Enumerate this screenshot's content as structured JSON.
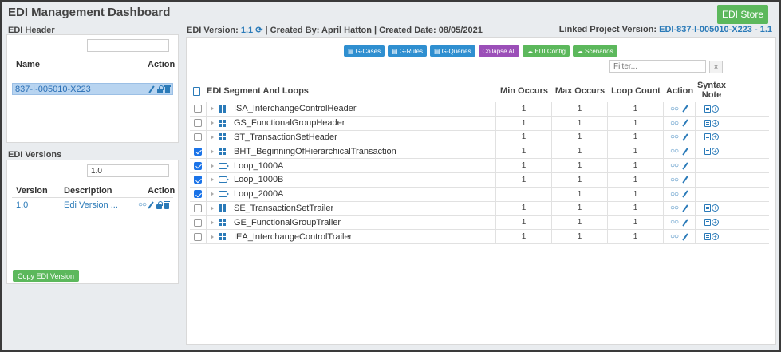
{
  "app": {
    "title": "EDI Management Dashboard",
    "store_button": "EDI Store"
  },
  "edi_header": {
    "section_label": "EDI Header",
    "search_value": "",
    "col_name": "Name",
    "col_action": "Action",
    "rows": [
      {
        "name": "837-I-005010-X223"
      }
    ]
  },
  "edi_versions": {
    "section_label": "EDI Versions",
    "search_value": "1.0",
    "col_version": "Version",
    "col_description": "Description",
    "col_action": "Action",
    "rows": [
      {
        "version": "1.0",
        "description": "Edi Version ..."
      }
    ],
    "copy_button": "Copy EDI Version"
  },
  "meta": {
    "version_label": "EDI Version:",
    "version_value": "1.1",
    "created_by_label": "| Created By:",
    "created_by_value": "April Hatton",
    "created_date_label": "| Created Date:",
    "created_date_value": "08/05/2021",
    "linked_label": "Linked Project Version:",
    "linked_value": "EDI-837-I-005010-X223 - 1.1"
  },
  "toolbar": {
    "g_cases": "G-Cases",
    "g_rules": "G-Rules",
    "g_queries": "G-Queries",
    "collapse_all": "Collapse All",
    "edi_config": "EDI Config",
    "scenarios": "Scenarios"
  },
  "filter": {
    "placeholder": "Filter...",
    "clear_label": "×"
  },
  "grid": {
    "col_segment": "EDI Segment And Loops",
    "col_min": "Min Occurs",
    "col_max": "Max Occurs",
    "col_loop": "Loop Count",
    "col_action": "Action",
    "col_syntax_line1": "Syntax",
    "col_syntax_line2": "Note",
    "rows": [
      {
        "name": "ISA_InterchangeControlHeader",
        "type": "segment",
        "checked": false,
        "min": "1",
        "max": "1",
        "loop": "1",
        "note": true
      },
      {
        "name": "GS_FunctionalGroupHeader",
        "type": "segment",
        "checked": false,
        "min": "1",
        "max": "1",
        "loop": "1",
        "note": true
      },
      {
        "name": "ST_TransactionSetHeader",
        "type": "segment",
        "checked": false,
        "min": "1",
        "max": "1",
        "loop": "1",
        "note": true
      },
      {
        "name": "BHT_BeginningOfHierarchicalTransaction",
        "type": "segment",
        "checked": true,
        "min": "1",
        "max": "1",
        "loop": "1",
        "note": true
      },
      {
        "name": "Loop_1000A",
        "type": "loop",
        "checked": true,
        "min": "1",
        "max": "1",
        "loop": "1",
        "note": false
      },
      {
        "name": "Loop_1000B",
        "type": "loop",
        "checked": true,
        "min": "1",
        "max": "1",
        "loop": "1",
        "note": false
      },
      {
        "name": "Loop_2000A",
        "type": "loop",
        "checked": true,
        "min": "",
        "max": "1",
        "loop": "1",
        "note": false
      },
      {
        "name": "SE_TransactionSetTrailer",
        "type": "segment",
        "checked": false,
        "min": "1",
        "max": "1",
        "loop": "1",
        "note": true
      },
      {
        "name": "GE_FunctionalGroupTrailer",
        "type": "segment",
        "checked": false,
        "min": "1",
        "max": "1",
        "loop": "1",
        "note": true
      },
      {
        "name": "IEA_InterchangeControlTrailer",
        "type": "segment",
        "checked": false,
        "min": "1",
        "max": "1",
        "loop": "1",
        "note": true
      }
    ]
  }
}
